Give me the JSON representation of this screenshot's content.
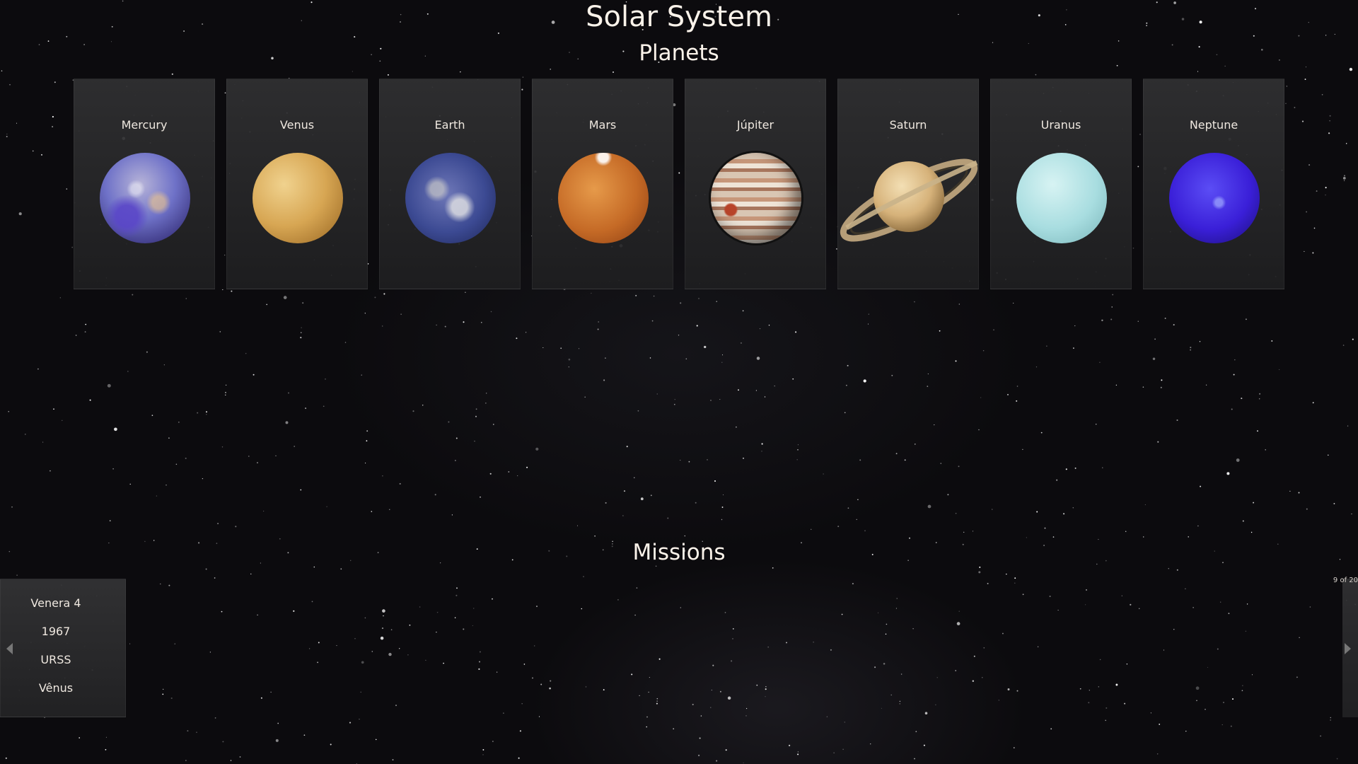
{
  "header": {
    "title": "Solar System"
  },
  "planets": {
    "heading": "Planets",
    "items": [
      {
        "name": "Mercury",
        "icon": "mercury-icon"
      },
      {
        "name": "Venus",
        "icon": "venus-icon"
      },
      {
        "name": "Earth",
        "icon": "earth-icon"
      },
      {
        "name": "Mars",
        "icon": "mars-icon"
      },
      {
        "name": "Júpiter",
        "icon": "jupiter-icon"
      },
      {
        "name": "Saturn",
        "icon": "saturn-icon"
      },
      {
        "name": "Uranus",
        "icon": "uranus-icon"
      },
      {
        "name": "Neptune",
        "icon": "neptune-icon"
      }
    ]
  },
  "missions": {
    "heading": "Missions",
    "current": {
      "name": "Venera 4",
      "year": "1967",
      "agency": "URSS",
      "target": "Vênus"
    },
    "counter": "9 of 20",
    "prev_icon": "chevron-left-icon",
    "next_icon": "chevron-right-icon"
  },
  "colors": {
    "background": "#0c0b0e",
    "card": "#2f2f31",
    "text": "#f1ece6"
  }
}
